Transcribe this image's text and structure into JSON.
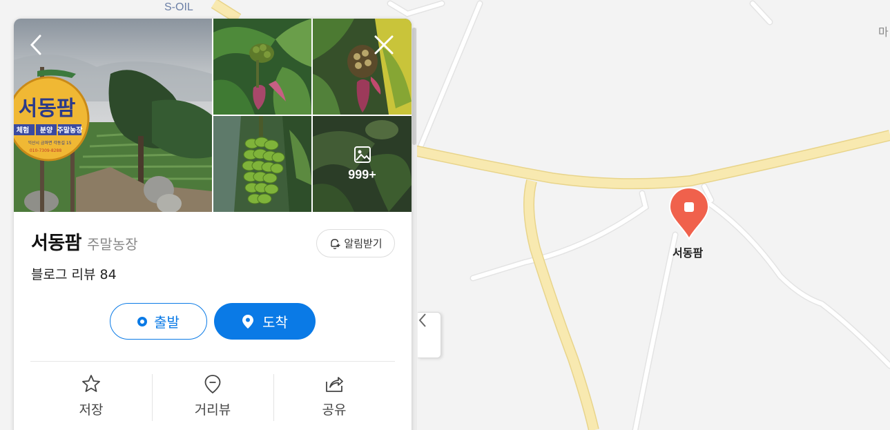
{
  "map": {
    "labels": {
      "soil": "S-OIL",
      "corner": "마"
    },
    "poi_label": "서동팜",
    "collapse_icon": "chevron-left-icon"
  },
  "place": {
    "name": "서동팜",
    "category": "주말농장",
    "alert_label": "알림받기",
    "review_text": "블로그 리뷰 84",
    "depart_label": "출발",
    "arrive_label": "도착",
    "photo_more_count": "999+",
    "sign": {
      "name": "서동팜",
      "tags": [
        "체험",
        "분양",
        "주말농장"
      ],
      "address": "익산시 금마면 각동길 15",
      "phone": "010-7309-8288"
    }
  },
  "actions": [
    {
      "label": "저장",
      "icon": "star-icon"
    },
    {
      "label": "거리뷰",
      "icon": "location-pin-icon"
    },
    {
      "label": "공유",
      "icon": "share-icon"
    }
  ],
  "colors": {
    "accent": "#0a7ae6",
    "marker": "#f0614c",
    "road_major": "#f6e4a3",
    "map_bg": "#f3f3f3"
  }
}
